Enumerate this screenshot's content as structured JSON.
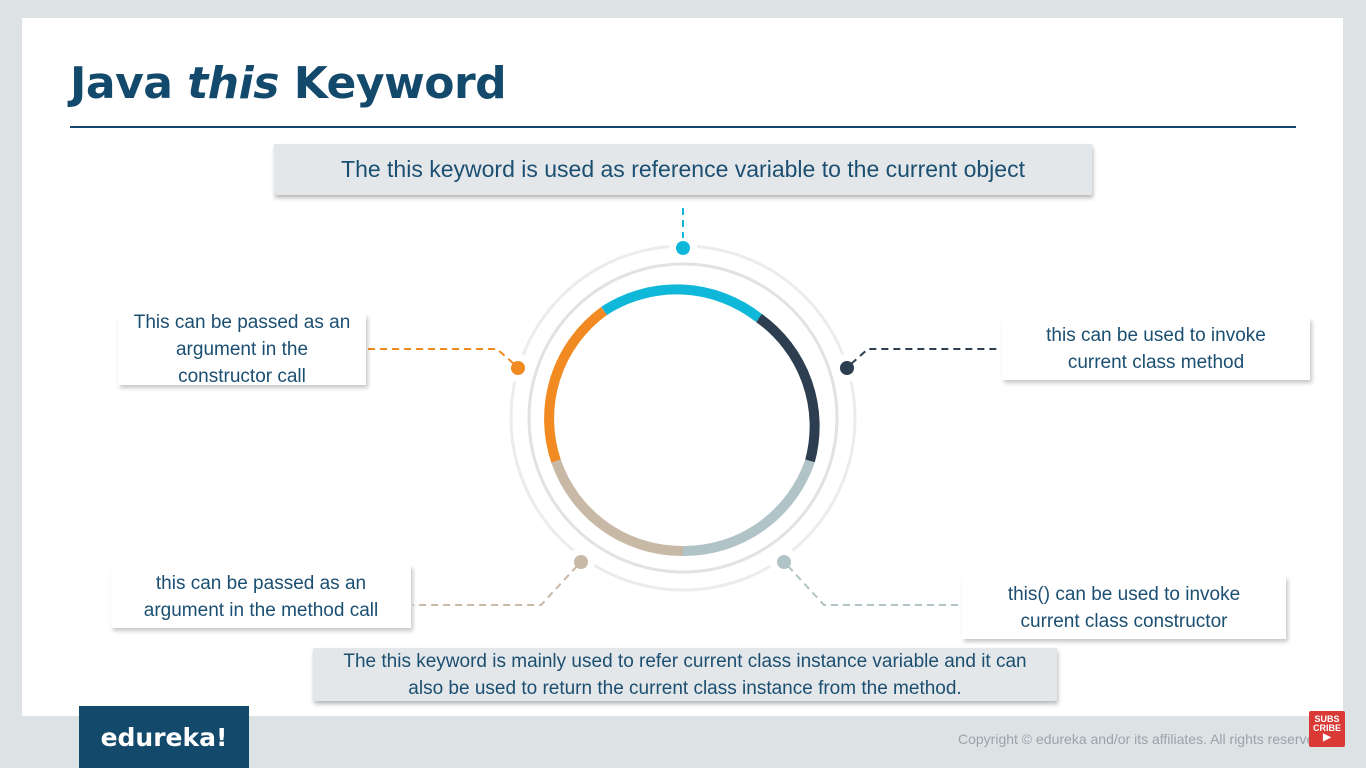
{
  "slide": {
    "title_pre": "Java",
    "title_em": "this",
    "title_post": "Keyword"
  },
  "top_box": {
    "text": "The this keyword is used as reference variable to the current object"
  },
  "points": {
    "top_left": "This can be passed as an\nargument in the\nconstructor call",
    "top_right": "this can be used to invoke\ncurrent class method",
    "bottom_left": "this can be passed as an\nargument in the method call",
    "bottom_right": "this() can be used to invoke\ncurrent class constructor"
  },
  "bottom_box": {
    "text": "The this keyword is mainly used to refer current class instance variable and it can also be used to return the current class instance from the method."
  },
  "footer": {
    "logo": "edureka!",
    "copyright": "Copyright © edureka and/or its affiliates. All rights reserved.",
    "subscribe_line1": "SUBS",
    "subscribe_line2": "CRIBE"
  },
  "colors": {
    "title": "#134a6c",
    "text": "#1b4f72",
    "segment_top": "#0fb8d8",
    "segment_right": "#2d3e50",
    "segment_bottom_right": "#b0c3c6",
    "segment_bottom_left": "#c8b8a6",
    "segment_left": "#f18a21",
    "outer_ring": "#e8e8e8",
    "subscribe": "#d93a36"
  },
  "icons": {
    "subscribe": "youtube-play-icon"
  }
}
